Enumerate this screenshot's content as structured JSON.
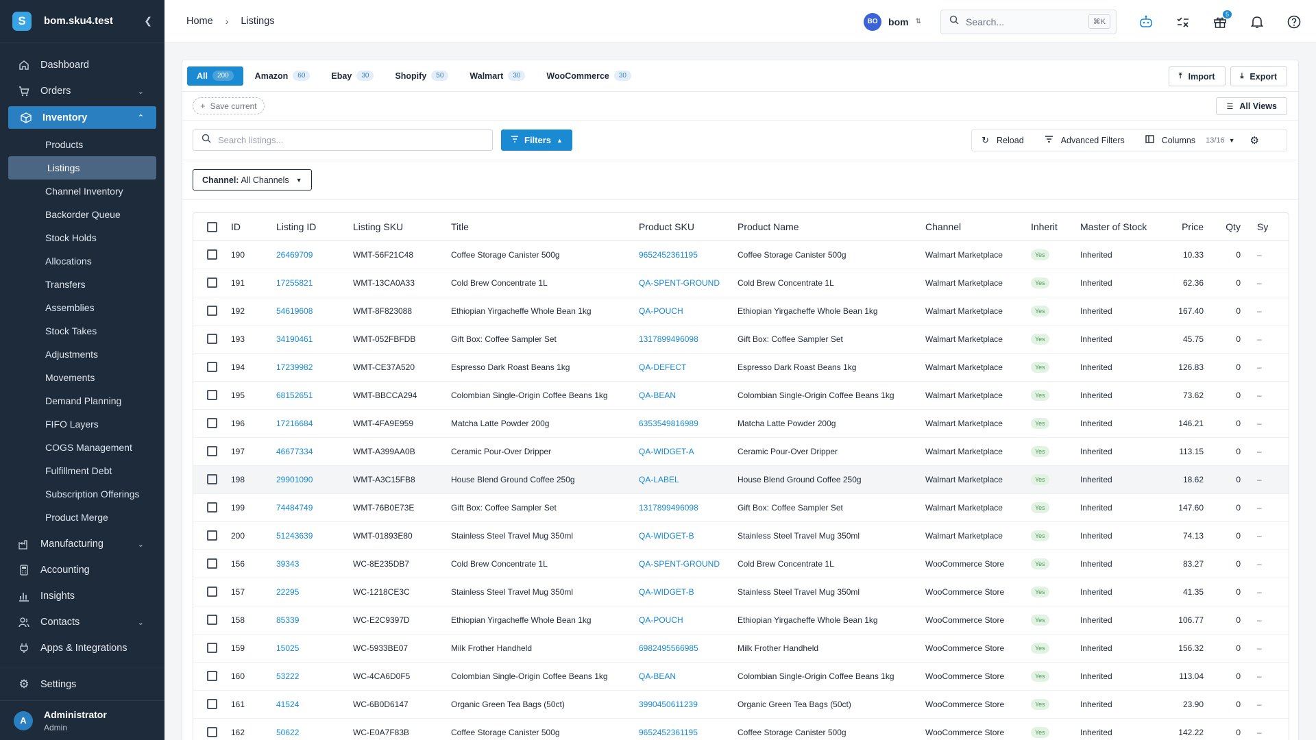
{
  "sidebar": {
    "logo_letter": "S",
    "site": "bom.sku4.test",
    "items_top": [
      {
        "label": "Dashboard",
        "icon": "home-icon"
      },
      {
        "label": "Orders",
        "icon": "cart-icon",
        "chevron": true
      }
    ],
    "inventory": {
      "label": "Inventory",
      "icon": "box-icon"
    },
    "sub_items": [
      "Products",
      "Listings",
      "Channel Inventory",
      "Backorder Queue",
      "Stock Holds",
      "Allocations",
      "Transfers",
      "Assemblies",
      "Stock Takes",
      "Adjustments",
      "Movements",
      "Demand Planning",
      "FIFO Layers",
      "COGS Management",
      "Fulfillment Debt",
      "Subscription Offerings",
      "Product Merge"
    ],
    "current_sub": "Listings",
    "items_bottom": [
      {
        "label": "Manufacturing",
        "icon": "factory-icon",
        "chevron": true
      },
      {
        "label": "Accounting",
        "icon": "calculator-icon"
      },
      {
        "label": "Insights",
        "icon": "bar-chart-icon"
      },
      {
        "label": "Contacts",
        "icon": "contacts-icon",
        "chevron": true
      },
      {
        "label": "Apps & Integrations",
        "icon": "plug-icon"
      }
    ],
    "settings": "Settings",
    "user": {
      "initial": "A",
      "name": "Administrator",
      "role": "Admin"
    }
  },
  "topbar": {
    "breadcrumb": [
      "Home",
      "Listings"
    ],
    "org_badge": "BO",
    "org_name": "bom",
    "search_placeholder": "Search...",
    "search_shortcut": "⌘K",
    "gift_badge": "5"
  },
  "tabs": [
    {
      "label": "All",
      "count": "200",
      "active": true
    },
    {
      "label": "Amazon",
      "count": "60"
    },
    {
      "label": "Ebay",
      "count": "30"
    },
    {
      "label": "Shopify",
      "count": "50"
    },
    {
      "label": "Walmart",
      "count": "30"
    },
    {
      "label": "WooCommerce",
      "count": "30"
    }
  ],
  "actions": {
    "import": "Import",
    "export": "Export",
    "save_current": "Save current",
    "all_views": "All Views"
  },
  "filters": {
    "search_placeholder": "Search listings...",
    "filters_label": "Filters",
    "reload": "Reload",
    "advanced": "Advanced Filters",
    "columns": "Columns",
    "columns_count": "13/16",
    "channel_label": "Channel:",
    "channel_value": "All Channels"
  },
  "table": {
    "columns": [
      "ID",
      "Listing ID",
      "Listing SKU",
      "Title",
      "Product SKU",
      "Product Name",
      "Channel",
      "Inherit",
      "Master of Stock",
      "Price",
      "Qty",
      "Sy"
    ],
    "rows": [
      [
        "190",
        "26469709",
        "WMT-56F21C48",
        "Coffee Storage Canister 500g",
        "9652452361195",
        "Coffee Storage Canister 500g",
        "Walmart Marketplace",
        "Yes",
        "Inherited",
        "10.33",
        "0",
        "–"
      ],
      [
        "191",
        "17255821",
        "WMT-13CA0A33",
        "Cold Brew Concentrate 1L",
        "QA-SPENT-GROUND",
        "Cold Brew Concentrate 1L",
        "Walmart Marketplace",
        "Yes",
        "Inherited",
        "62.36",
        "0",
        "–"
      ],
      [
        "192",
        "54619608",
        "WMT-8F823088",
        "Ethiopian Yirgacheffe Whole Bean 1kg",
        "QA-POUCH",
        "Ethiopian Yirgacheffe Whole Bean 1kg",
        "Walmart Marketplace",
        "Yes",
        "Inherited",
        "167.40",
        "0",
        "–"
      ],
      [
        "193",
        "34190461",
        "WMT-052FBFDB",
        "Gift Box: Coffee Sampler Set",
        "1317899496098",
        "Gift Box: Coffee Sampler Set",
        "Walmart Marketplace",
        "Yes",
        "Inherited",
        "45.75",
        "0",
        "–"
      ],
      [
        "194",
        "17239982",
        "WMT-CE37A520",
        "Espresso Dark Roast Beans 1kg",
        "QA-DEFECT",
        "Espresso Dark Roast Beans 1kg",
        "Walmart Marketplace",
        "Yes",
        "Inherited",
        "126.83",
        "0",
        "–"
      ],
      [
        "195",
        "68152651",
        "WMT-BBCCA294",
        "Colombian Single-Origin Coffee Beans 1kg",
        "QA-BEAN",
        "Colombian Single-Origin Coffee Beans 1kg",
        "Walmart Marketplace",
        "Yes",
        "Inherited",
        "73.62",
        "0",
        "–"
      ],
      [
        "196",
        "17216684",
        "WMT-4FA9E959",
        "Matcha Latte Powder 200g",
        "6353549816989",
        "Matcha Latte Powder 200g",
        "Walmart Marketplace",
        "Yes",
        "Inherited",
        "146.21",
        "0",
        "–"
      ],
      [
        "197",
        "46677334",
        "WMT-A399AA0B",
        "Ceramic Pour-Over Dripper",
        "QA-WIDGET-A",
        "Ceramic Pour-Over Dripper",
        "Walmart Marketplace",
        "Yes",
        "Inherited",
        "113.15",
        "0",
        "–"
      ],
      [
        "198",
        "29901090",
        "WMT-A3C15FB8",
        "House Blend Ground Coffee 250g",
        "QA-LABEL",
        "House Blend Ground Coffee 250g",
        "Walmart Marketplace",
        "Yes",
        "Inherited",
        "18.62",
        "0",
        "–"
      ],
      [
        "199",
        "74484749",
        "WMT-76B0E73E",
        "Gift Box: Coffee Sampler Set",
        "1317899496098",
        "Gift Box: Coffee Sampler Set",
        "Walmart Marketplace",
        "Yes",
        "Inherited",
        "147.60",
        "0",
        "–"
      ],
      [
        "200",
        "51243639",
        "WMT-01893E80",
        "Stainless Steel Travel Mug 350ml",
        "QA-WIDGET-B",
        "Stainless Steel Travel Mug 350ml",
        "Walmart Marketplace",
        "Yes",
        "Inherited",
        "74.13",
        "0",
        "–"
      ],
      [
        "156",
        "39343",
        "WC-8E235DB7",
        "Cold Brew Concentrate 1L",
        "QA-SPENT-GROUND",
        "Cold Brew Concentrate 1L",
        "WooCommerce Store",
        "Yes",
        "Inherited",
        "83.27",
        "0",
        "–"
      ],
      [
        "157",
        "22295",
        "WC-1218CE3C",
        "Stainless Steel Travel Mug 350ml",
        "QA-WIDGET-B",
        "Stainless Steel Travel Mug 350ml",
        "WooCommerce Store",
        "Yes",
        "Inherited",
        "41.35",
        "0",
        "–"
      ],
      [
        "158",
        "85339",
        "WC-E2C9397D",
        "Ethiopian Yirgacheffe Whole Bean 1kg",
        "QA-POUCH",
        "Ethiopian Yirgacheffe Whole Bean 1kg",
        "WooCommerce Store",
        "Yes",
        "Inherited",
        "106.77",
        "0",
        "–"
      ],
      [
        "159",
        "15025",
        "WC-5933BE07",
        "Milk Frother Handheld",
        "6982495566985",
        "Milk Frother Handheld",
        "WooCommerce Store",
        "Yes",
        "Inherited",
        "156.32",
        "0",
        "–"
      ],
      [
        "160",
        "53222",
        "WC-4CA6D0F5",
        "Colombian Single-Origin Coffee Beans 1kg",
        "QA-BEAN",
        "Colombian Single-Origin Coffee Beans 1kg",
        "WooCommerce Store",
        "Yes",
        "Inherited",
        "113.04",
        "0",
        "–"
      ],
      [
        "161",
        "41524",
        "WC-6B0D6147",
        "Organic Green Tea Bags (50ct)",
        "3990450611239",
        "Organic Green Tea Bags (50ct)",
        "WooCommerce Store",
        "Yes",
        "Inherited",
        "23.90",
        "0",
        "–"
      ],
      [
        "162",
        "50622",
        "WC-E0A7F83B",
        "Coffee Storage Canister 500g",
        "9652452361195",
        "Coffee Storage Canister 500g",
        "WooCommerce Store",
        "Yes",
        "Inherited",
        "142.22",
        "0",
        "–"
      ]
    ],
    "highlight_row": 8
  }
}
